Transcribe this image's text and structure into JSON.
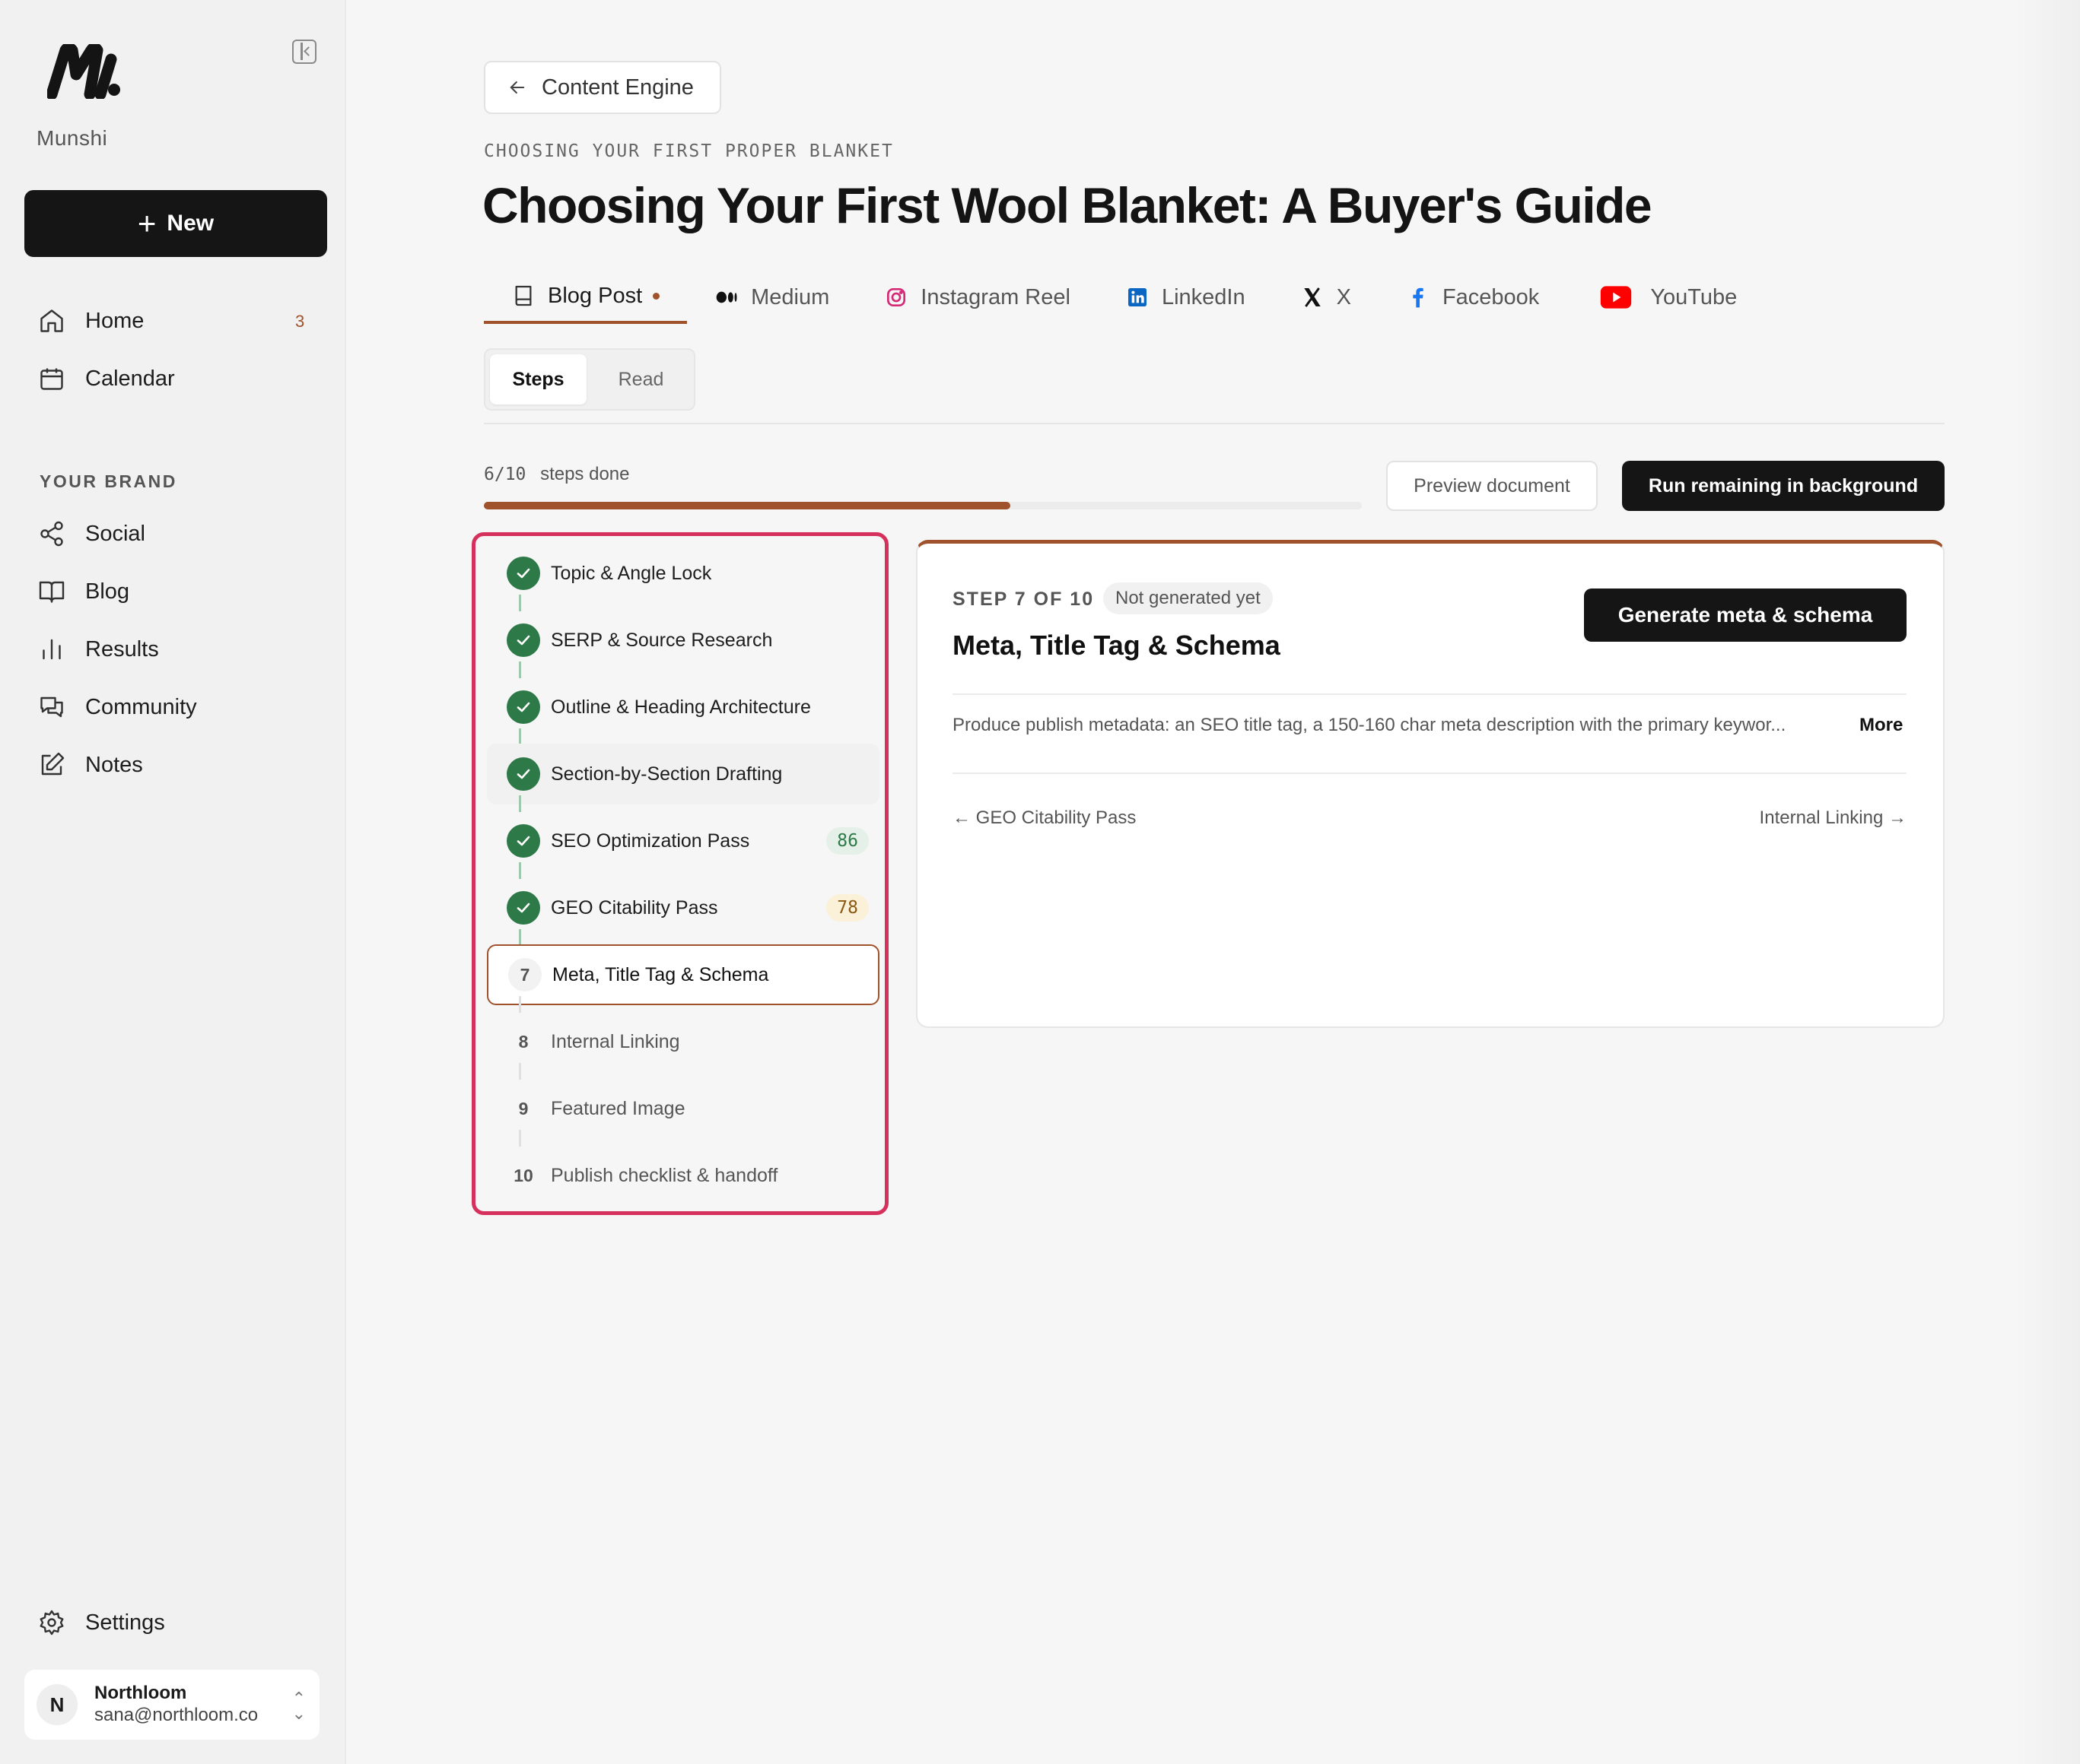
{
  "app": {
    "name": "Munshi"
  },
  "sidebar": {
    "new_label": "New",
    "items": [
      {
        "label": "Home",
        "badge": "3"
      },
      {
        "label": "Calendar"
      }
    ],
    "section_label": "YOUR BRAND",
    "brand_items": [
      {
        "label": "Social"
      },
      {
        "label": "Blog"
      },
      {
        "label": "Results"
      },
      {
        "label": "Community"
      },
      {
        "label": "Notes"
      }
    ],
    "settings_label": "Settings",
    "user": {
      "initial": "N",
      "name": "Northloom",
      "email": "sana@northloom.co"
    }
  },
  "header": {
    "back_label": "Content Engine",
    "eyebrow": "CHOOSING YOUR FIRST PROPER BLANKET",
    "title": "Choosing Your First Wool Blanket: A Buyer's Guide"
  },
  "channel_tabs": [
    {
      "label": "Blog Post",
      "icon": "book-icon",
      "active": true
    },
    {
      "label": "Medium",
      "icon": "medium-icon"
    },
    {
      "label": "Instagram Reel",
      "icon": "instagram-icon"
    },
    {
      "label": "LinkedIn",
      "icon": "linkedin-icon"
    },
    {
      "label": "X",
      "icon": "x-icon"
    },
    {
      "label": "Facebook",
      "icon": "facebook-icon"
    },
    {
      "label": "YouTube",
      "icon": "youtube-icon"
    }
  ],
  "view_toggle": {
    "options": [
      "Steps",
      "Read"
    ],
    "selected": "Steps"
  },
  "progress": {
    "count": "6/10",
    "label": "steps done",
    "fraction": 0.6
  },
  "actions": {
    "preview": "Preview document",
    "run": "Run remaining in background"
  },
  "steps": [
    {
      "n": "1",
      "label": "Topic & Angle Lock",
      "done": true
    },
    {
      "n": "2",
      "label": "SERP & Source Research",
      "done": true
    },
    {
      "n": "3",
      "label": "Outline & Heading Architecture",
      "done": true
    },
    {
      "n": "4",
      "label": "Section-by-Section Drafting",
      "done": true
    },
    {
      "n": "5",
      "label": "SEO Optimization Pass",
      "done": true,
      "score": "86"
    },
    {
      "n": "6",
      "label": "GEO Citability Pass",
      "done": true,
      "score": "78"
    },
    {
      "n": "7",
      "label": "Meta, Title Tag & Schema",
      "current": true
    },
    {
      "n": "8",
      "label": "Internal Linking"
    },
    {
      "n": "9",
      "label": "Featured Image"
    },
    {
      "n": "10",
      "label": "Publish checklist & handoff"
    }
  ],
  "detail": {
    "step_no": "STEP 7 OF 10",
    "status": "Not generated yet",
    "title": "Meta, Title Tag & Schema",
    "generate_label": "Generate meta & schema",
    "description": "Produce publish metadata: an SEO title tag, a 150-160 char meta description with the primary keywor...",
    "more_label": "More",
    "prev_label": "← GEO Citability Pass",
    "next_label": "Internal Linking →"
  },
  "colors": {
    "accent": "#a0522d",
    "success": "#2d7a48",
    "highlight": "#d6305c",
    "primary_button": "#151515"
  }
}
